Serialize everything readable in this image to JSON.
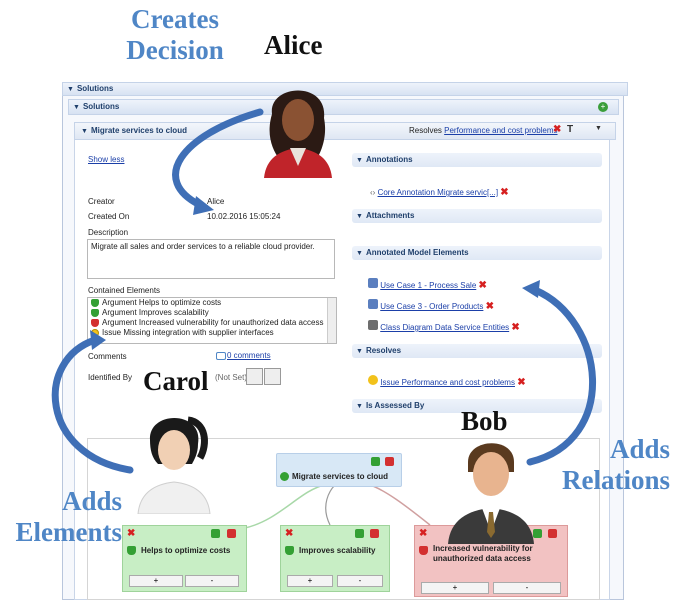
{
  "annotations": {
    "creates_decision": "Creates\nDecision",
    "alice": "Alice",
    "carol": "Carol",
    "bob": "Bob",
    "adds_elements": "Adds\nElements",
    "adds_relations": "Adds\nRelations"
  },
  "solutions_outer": "Solutions",
  "solutions_inner": "Solutions",
  "decision": {
    "title": "Migrate services to cloud",
    "resolves_label": "Resolves",
    "resolves_link": "Performance and cost problems",
    "show_less": "Show less",
    "creator_label": "Creator",
    "creator_value": "Alice",
    "created_on_label": "Created On",
    "created_on_value": "10.02.2016 15:05:24",
    "description_label": "Description",
    "description_value": "Migrate all sales and order services to a reliable cloud provider.",
    "contained_label": "Contained Elements",
    "contained_items": [
      "Argument Helps to optimize costs",
      "Argument Improves scalability",
      "Argument Increased vulnerability for unauthorized data access",
      "Issue Missing integration with supplier interfaces"
    ],
    "comments_label": "Comments",
    "comments_link": "0 comments",
    "identified_label": "Identified By",
    "identified_value": "(Not Set)"
  },
  "right": {
    "annotations_hdr": "Annotations",
    "annotation_item": "Core Annotation Migrate servic[...]",
    "attachments_hdr": "Attachments",
    "annotated_hdr": "Annotated Model Elements",
    "model_items": [
      "Use Case 1 - Process Sale",
      "Use Case 3 - Order Products",
      "Class Diagram Data Service Entities"
    ],
    "resolves_hdr": "Resolves",
    "resolves_item": "Issue Performance and cost problems",
    "assessed_hdr": "Is Assessed By"
  },
  "diagram": {
    "center_node": "Migrate services to cloud",
    "node1": "Helps to optimize costs",
    "node2": "Improves scalability",
    "node3": "Increased vulnerability for\nunauthorized data access",
    "plus": "+",
    "minus": "-"
  }
}
